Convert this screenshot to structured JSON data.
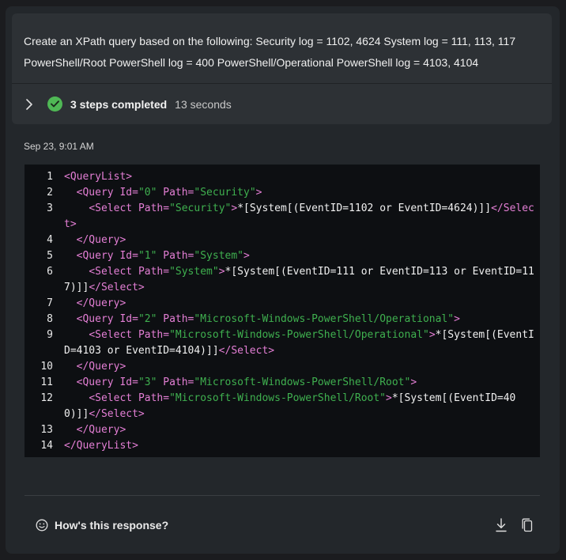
{
  "prompt": {
    "line1": "Create an XPath query based on the following: Security log = 1102, 4624 System log = 111, 113, 117",
    "line2": "PowerShell/Root PowerShell log = 400 PowerShell/Operational PowerShell log = 4103, 4104"
  },
  "steps": {
    "label": "3 steps completed",
    "duration": "13 seconds",
    "status_color": "#4fb855"
  },
  "timestamp": "Sep 23, 9:01 AM",
  "code": {
    "lines": [
      {
        "n": "1",
        "tokens": [
          {
            "t": "tag",
            "v": "<QueryList>"
          }
        ]
      },
      {
        "n": "2",
        "tokens": [
          {
            "t": "plain",
            "v": "  "
          },
          {
            "t": "tag",
            "v": "<Query"
          },
          {
            "t": "plain",
            "v": " "
          },
          {
            "t": "attr",
            "v": "Id="
          },
          {
            "t": "str",
            "v": "\"0\""
          },
          {
            "t": "plain",
            "v": " "
          },
          {
            "t": "attr",
            "v": "Path="
          },
          {
            "t": "str",
            "v": "\"Security\""
          },
          {
            "t": "tag",
            "v": ">"
          }
        ]
      },
      {
        "n": "3",
        "tokens": [
          {
            "t": "plain",
            "v": "    "
          },
          {
            "t": "tag",
            "v": "<Select"
          },
          {
            "t": "plain",
            "v": " "
          },
          {
            "t": "attr",
            "v": "Path="
          },
          {
            "t": "str",
            "v": "\"Security\""
          },
          {
            "t": "tag",
            "v": ">"
          },
          {
            "t": "plain",
            "v": "*[System[(EventID=1102 or EventID=4624)]]"
          },
          {
            "t": "tag",
            "v": "</Select>"
          }
        ]
      },
      {
        "n": "4",
        "tokens": [
          {
            "t": "plain",
            "v": "  "
          },
          {
            "t": "tag",
            "v": "</Query>"
          }
        ]
      },
      {
        "n": "5",
        "tokens": [
          {
            "t": "plain",
            "v": "  "
          },
          {
            "t": "tag",
            "v": "<Query"
          },
          {
            "t": "plain",
            "v": " "
          },
          {
            "t": "attr",
            "v": "Id="
          },
          {
            "t": "str",
            "v": "\"1\""
          },
          {
            "t": "plain",
            "v": " "
          },
          {
            "t": "attr",
            "v": "Path="
          },
          {
            "t": "str",
            "v": "\"System\""
          },
          {
            "t": "tag",
            "v": ">"
          }
        ]
      },
      {
        "n": "6",
        "tokens": [
          {
            "t": "plain",
            "v": "    "
          },
          {
            "t": "tag",
            "v": "<Select"
          },
          {
            "t": "plain",
            "v": " "
          },
          {
            "t": "attr",
            "v": "Path="
          },
          {
            "t": "str",
            "v": "\"System\""
          },
          {
            "t": "tag",
            "v": ">"
          },
          {
            "t": "plain",
            "v": "*[System[(EventID=111 or EventID=113 or EventID=117)]]"
          },
          {
            "t": "tag",
            "v": "</Select>"
          }
        ]
      },
      {
        "n": "7",
        "tokens": [
          {
            "t": "plain",
            "v": "  "
          },
          {
            "t": "tag",
            "v": "</Query>"
          }
        ]
      },
      {
        "n": "8",
        "tokens": [
          {
            "t": "plain",
            "v": "  "
          },
          {
            "t": "tag",
            "v": "<Query"
          },
          {
            "t": "plain",
            "v": " "
          },
          {
            "t": "attr",
            "v": "Id="
          },
          {
            "t": "str",
            "v": "\"2\""
          },
          {
            "t": "plain",
            "v": " "
          },
          {
            "t": "attr",
            "v": "Path="
          },
          {
            "t": "str",
            "v": "\"Microsoft-Windows-PowerShell/Operational\""
          },
          {
            "t": "tag",
            "v": ">"
          }
        ]
      },
      {
        "n": "9",
        "tokens": [
          {
            "t": "plain",
            "v": "    "
          },
          {
            "t": "tag",
            "v": "<Select"
          },
          {
            "t": "plain",
            "v": " "
          },
          {
            "t": "attr",
            "v": "Path="
          },
          {
            "t": "str",
            "v": "\"Microsoft-Windows-PowerShell/Operational\""
          },
          {
            "t": "tag",
            "v": ">"
          },
          {
            "t": "plain",
            "v": "*[System[(EventID=4103 or EventID=4104)]]"
          },
          {
            "t": "tag",
            "v": "</Select>"
          }
        ]
      },
      {
        "n": "10",
        "tokens": [
          {
            "t": "plain",
            "v": "  "
          },
          {
            "t": "tag",
            "v": "</Query>"
          }
        ]
      },
      {
        "n": "11",
        "tokens": [
          {
            "t": "plain",
            "v": "  "
          },
          {
            "t": "tag",
            "v": "<Query"
          },
          {
            "t": "plain",
            "v": " "
          },
          {
            "t": "attr",
            "v": "Id="
          },
          {
            "t": "str",
            "v": "\"3\""
          },
          {
            "t": "plain",
            "v": " "
          },
          {
            "t": "attr",
            "v": "Path="
          },
          {
            "t": "str",
            "v": "\"Microsoft-Windows-PowerShell/Root\""
          },
          {
            "t": "tag",
            "v": ">"
          }
        ]
      },
      {
        "n": "12",
        "tokens": [
          {
            "t": "plain",
            "v": "    "
          },
          {
            "t": "tag",
            "v": "<Select"
          },
          {
            "t": "plain",
            "v": " "
          },
          {
            "t": "attr",
            "v": "Path="
          },
          {
            "t": "str",
            "v": "\"Microsoft-Windows-PowerShell/Root\""
          },
          {
            "t": "tag",
            "v": ">"
          },
          {
            "t": "plain",
            "v": "*[System[(EventID=400)]]"
          },
          {
            "t": "tag",
            "v": "</Select>"
          }
        ]
      },
      {
        "n": "13",
        "tokens": [
          {
            "t": "plain",
            "v": "  "
          },
          {
            "t": "tag",
            "v": "</Query>"
          }
        ]
      },
      {
        "n": "14",
        "tokens": [
          {
            "t": "tag",
            "v": "</QueryList>"
          }
        ]
      }
    ]
  },
  "feedback": {
    "label": "How's this response?"
  },
  "icons": {
    "expand": "chevron-right-icon",
    "status": "check-circle-icon",
    "feedback": "smiley-icon",
    "download": "download-icon",
    "copy": "copy-icon"
  },
  "colors": {
    "tag": "#e47fd5",
    "string": "#3fb04f",
    "code_bg": "#0d0f12"
  }
}
